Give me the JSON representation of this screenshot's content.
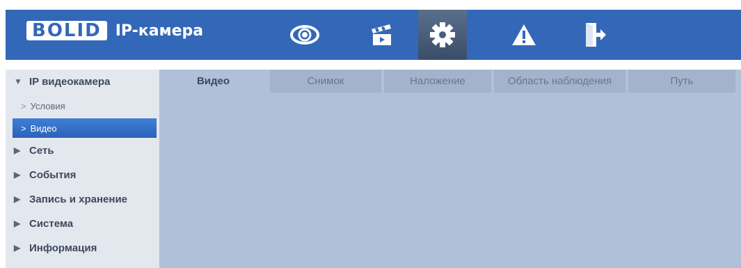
{
  "header": {
    "brand": "BOLID",
    "product": "IP-камера",
    "nav": [
      {
        "name": "live-view",
        "icon": "eye-icon"
      },
      {
        "name": "playback",
        "icon": "clapperboard-icon"
      },
      {
        "name": "settings",
        "icon": "gear-icon",
        "active": true
      },
      {
        "name": "alarm",
        "icon": "warning-icon"
      },
      {
        "name": "logout",
        "icon": "exit-icon"
      }
    ]
  },
  "sidebar": {
    "ip_camera": "IP видеокамера",
    "conditions": "Условия",
    "video": "Видео",
    "network": "Сеть",
    "events": "События",
    "storage": "Запись и хранение",
    "system": "Система",
    "info": "Информация"
  },
  "tabs": {
    "video": "Видео",
    "snapshot": "Снимок",
    "overlay": "Наложение",
    "area": "Область наблюдения",
    "path": "Путь"
  },
  "colors": {
    "header": "#3368b8",
    "sidebar_bg": "#e3e7ee",
    "active_item": "#2b63b8",
    "content_bg": "#b0c0d8"
  }
}
